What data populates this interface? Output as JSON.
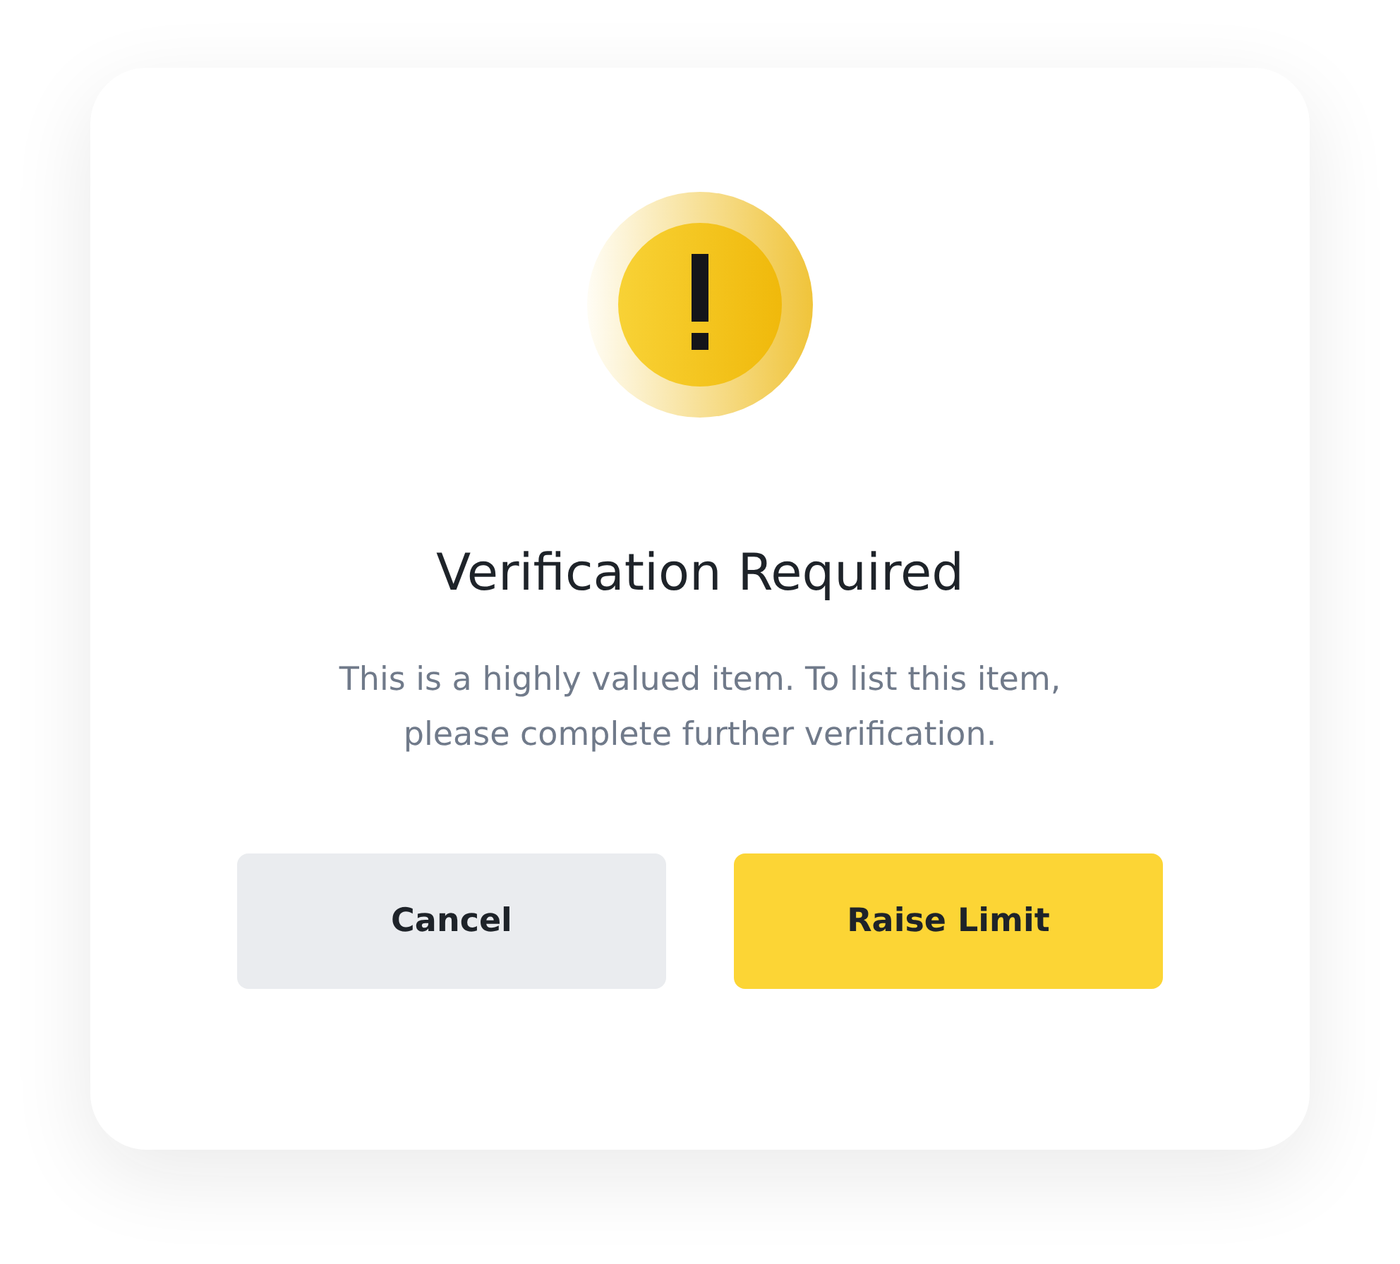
{
  "dialog": {
    "title": "Verification Required",
    "message": "This is a highly valued item. To list this item, please complete further verification.",
    "buttons": [
      {
        "label": "Cancel",
        "kind": "secondary"
      },
      {
        "label": "Raise Limit",
        "kind": "primary"
      }
    ]
  }
}
